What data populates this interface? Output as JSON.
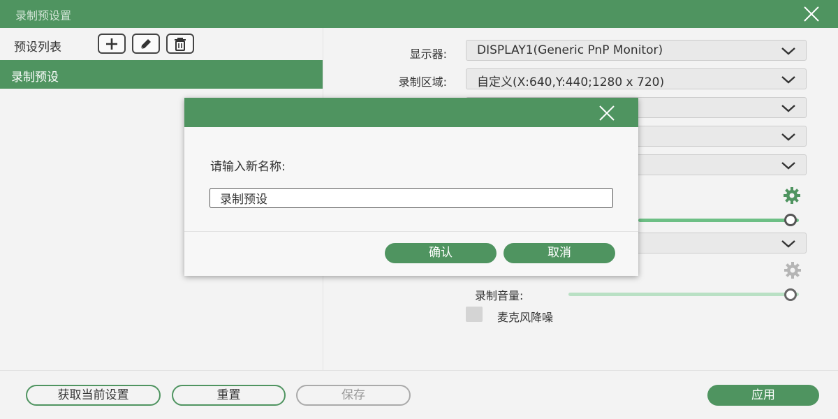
{
  "window": {
    "title": "录制预设置"
  },
  "sidebar": {
    "header_label": "预设列表",
    "items": [
      {
        "label": "录制预设"
      }
    ]
  },
  "settings": {
    "display_label": "显示器:",
    "display_value": "DISPLAY1(Generic PnP Monitor)",
    "region_label": "录制区域:",
    "region_value": "自定义(X:640,Y:440;1280 x 720)",
    "record_volume_label": "录制音量:",
    "record_volume_level": 1.0,
    "system_volume_level": 1.0,
    "mic_noise_label": "麦克风降噪"
  },
  "footer": {
    "get_current_label": "获取当前设置",
    "reset_label": "重置",
    "save_label": "保存",
    "apply_label": "应用"
  },
  "dialog": {
    "prompt": "请输入新名称:",
    "input_value": "录制预设",
    "confirm_label": "确认",
    "cancel_label": "取消"
  },
  "colors": {
    "accent": "#4f9460",
    "slider_fill": "#6dbf85",
    "slider_light": "#b9e0c4"
  }
}
